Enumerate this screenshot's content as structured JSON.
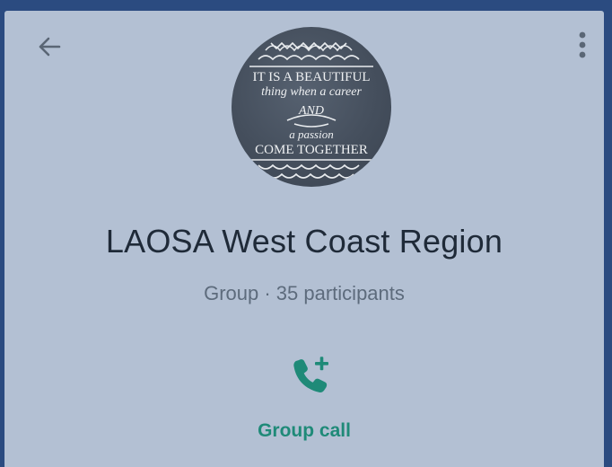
{
  "header": {
    "back_icon": "arrow-left-icon",
    "menu_icon": "more-vertical-icon"
  },
  "avatar": {
    "description_icon": "group-avatar-image",
    "lines": [
      "IT IS A BEAUTIFUL",
      "thing when a career",
      "AND",
      "a passion",
      "COME TOGETHER"
    ]
  },
  "group": {
    "name": "LAOSA West Coast Region",
    "meta": "Group · 35 participants"
  },
  "actions": {
    "call_icon": "add-call-icon",
    "call_label": "Group call"
  },
  "colors": {
    "background": "#b3c0d3",
    "accent": "#1f8a78",
    "border": "#2b4b80"
  }
}
